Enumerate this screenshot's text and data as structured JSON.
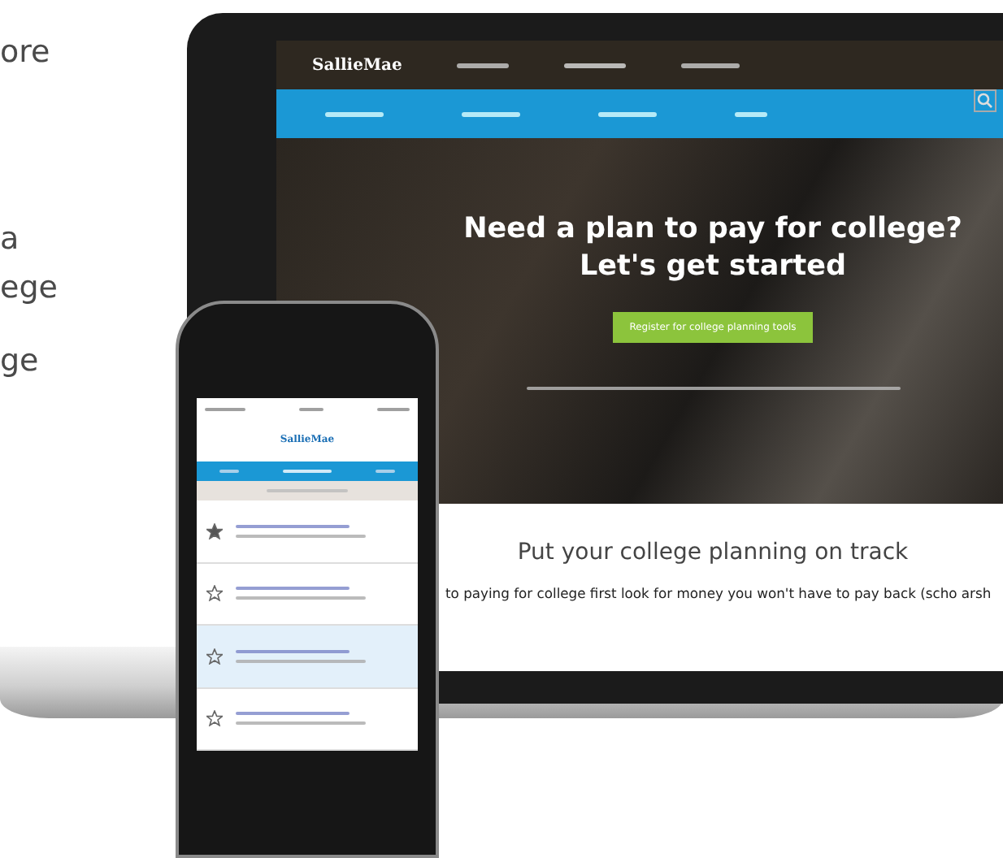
{
  "side_text": [
    "ore",
    "a",
    "ege",
    "ge"
  ],
  "laptop": {
    "logo": "SallieMae",
    "headline": [
      "Need a plan to pay for college?",
      "Let's get started"
    ],
    "cta": "Register for college planning tools",
    "section_title": "Put your college planning on track",
    "body": "to paying for college first look for money you won't have to pay back (scho arsh"
  },
  "phone": {
    "logo": "SallieMae",
    "items": [
      {
        "starred": true,
        "selected": false
      },
      {
        "starred": false,
        "selected": false
      },
      {
        "starred": false,
        "selected": true
      },
      {
        "starred": false,
        "selected": false
      }
    ]
  }
}
